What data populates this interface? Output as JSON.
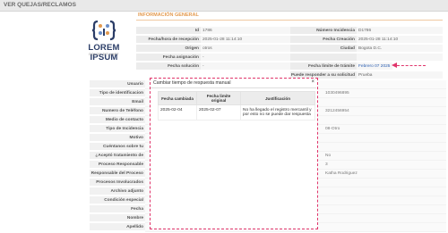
{
  "header": {
    "title": "VER QUEJAS/RECLAMOS"
  },
  "logo": {
    "name": "LOREM IPSUM",
    "tagline": "DOLOR SIT AMET"
  },
  "section": {
    "title": "INFORMACIÓN GENERAL"
  },
  "info": {
    "left": [
      {
        "label": "Id",
        "value": "1786"
      },
      {
        "label": "Fecha/hora de recepción",
        "value": "2025-01-28 11:14:10"
      },
      {
        "label": "Origen",
        "value": "otros"
      },
      {
        "label": "Fecha asignación",
        "value": "-"
      },
      {
        "label": "Fecha solución",
        "value": "-"
      }
    ],
    "right": [
      {
        "label": "Número Incidencia",
        "value": "D1786"
      },
      {
        "label": "Fecha Creación",
        "value": "2025-01-28 11:14:10"
      },
      {
        "label": "Ciudad",
        "value": "Bogota D.C."
      },
      {
        "label": "",
        "value": ""
      },
      {
        "label": "Fecha límite de trámite",
        "value": "Febrero 07 2025"
      },
      {
        "label": "Puede responder a su solicitud",
        "value": "Prueba"
      }
    ]
  },
  "form": {
    "rows": [
      {
        "label": "Usuario",
        "value": ""
      },
      {
        "label": "Tipo de identificacion",
        "value": "1030496895"
      },
      {
        "label": "Email",
        "value": ""
      },
      {
        "label": "Numero de Teléfono",
        "value": "3212456954"
      },
      {
        "label": "Medio de contacto preferido",
        "value": ""
      },
      {
        "label": "Tipo de Incidencia",
        "value": "08-Otro"
      },
      {
        "label": "Motivo",
        "value": ""
      },
      {
        "label": "Cuéntanos sobre tu solicitud",
        "value": ""
      },
      {
        "label": "¿Aceptó tratamiento de datos?",
        "value": "No"
      },
      {
        "label": "Proceso Responsable",
        "value": "3"
      },
      {
        "label": "Responsable del Proceso",
        "value": "Katha Rodriguez"
      },
      {
        "label": "Procesos Involucrados",
        "value": ""
      },
      {
        "label": "Archivo adjunto",
        "value": ""
      },
      {
        "label": "Condición especial",
        "value": ""
      },
      {
        "label": "Fecha",
        "value": ""
      },
      {
        "label": "Nombre",
        "value": ""
      },
      {
        "label": "Apellido",
        "value": ""
      }
    ]
  },
  "modal": {
    "title": "Cambiar tiempo de respuesta manual",
    "close": "×",
    "columns": [
      "Fecha cambiada",
      "Fecha limite original",
      "Justificación"
    ],
    "rows": [
      {
        "changed": "2025-02-04",
        "original": "2025-02-07",
        "justification": "No ha llegado el registro mercantil y por esto no se puede dar respuesta"
      }
    ]
  },
  "colors": {
    "accent": "#e39a4f",
    "annotation": "#e0356b",
    "link": "#2a5db0"
  }
}
